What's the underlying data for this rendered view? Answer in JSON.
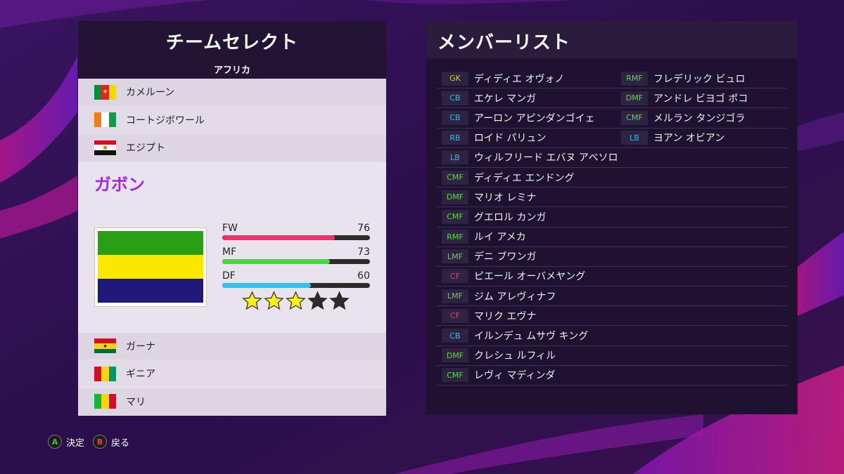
{
  "team_select": {
    "title": "チームセレクト",
    "region": "アフリカ",
    "countries_top": [
      {
        "name": "カメルーン",
        "flag": "cameroon"
      },
      {
        "name": "コートジボワール",
        "flag": "ivory-coast"
      },
      {
        "name": "エジプト",
        "flag": "egypt"
      }
    ],
    "selected": {
      "name": "ガボン",
      "flag": "gabon",
      "stats": [
        {
          "label": "FW",
          "value": 76,
          "color": "#e8336b"
        },
        {
          "label": "MF",
          "value": 73,
          "color": "#4fd443"
        },
        {
          "label": "DF",
          "value": 60,
          "color": "#37bde8"
        }
      ],
      "stars_filled": 3,
      "stars_total": 5
    },
    "countries_bottom": [
      {
        "name": "ガーナ",
        "flag": "ghana"
      },
      {
        "name": "ギニア",
        "flag": "guinea"
      },
      {
        "name": "マリ",
        "flag": "mali"
      }
    ]
  },
  "member_list": {
    "title": "メンバーリスト",
    "column1": [
      {
        "pos": "GK",
        "name": "ディディエ オヴォノ"
      },
      {
        "pos": "CB",
        "name": "エケレ マンガ"
      },
      {
        "pos": "CB",
        "name": "アーロン アピンダンゴイェ"
      },
      {
        "pos": "RB",
        "name": "ロイド パリュン"
      },
      {
        "pos": "LB",
        "name": "ウィルフリード エバヌ アベソロ"
      },
      {
        "pos": "CMF",
        "name": "ディディエ エンドング"
      },
      {
        "pos": "DMF",
        "name": "マリオ レミナ"
      },
      {
        "pos": "CMF",
        "name": "グエロル カンガ"
      },
      {
        "pos": "RMF",
        "name": "ルイ アメカ"
      },
      {
        "pos": "LMF",
        "name": "デニ ブワンガ"
      },
      {
        "pos": "CF",
        "name": "ピエール オーバメヤング"
      },
      {
        "pos": "LMF",
        "name": "ジム アレヴィナフ"
      },
      {
        "pos": "CF",
        "name": "マリク エヴナ"
      },
      {
        "pos": "CB",
        "name": "イルンデュ ムサヴ キング"
      },
      {
        "pos": "DMF",
        "name": "クレシュ ルフィル"
      },
      {
        "pos": "CMF",
        "name": "レヴィ マディンダ"
      }
    ],
    "column2": [
      {
        "pos": "RMF",
        "name": "フレデリック ビュロ"
      },
      {
        "pos": "DMF",
        "name": "アンドレ ビヨゴ ポコ"
      },
      {
        "pos": "CMF",
        "name": "メルラン タンジゴラ"
      },
      {
        "pos": "LB",
        "name": "ヨアン オビアン"
      }
    ]
  },
  "footer": {
    "confirm_key": "A",
    "confirm_label": "決定",
    "back_key": "B",
    "back_label": "戻る"
  }
}
